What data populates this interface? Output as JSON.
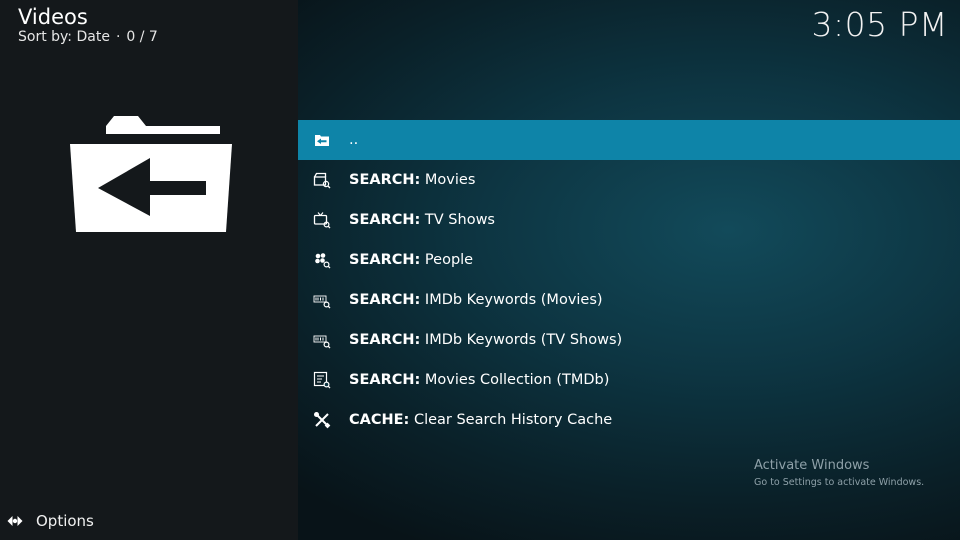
{
  "header": {
    "title": "Videos",
    "sort_label": "Sort by: Date",
    "position": "0 / 7",
    "clock": "3:05 PM"
  },
  "list": {
    "items": [
      {
        "icon": "back-folder-icon",
        "prefix": "",
        "text": ".."
      },
      {
        "icon": "movie-search-icon",
        "prefix": "SEARCH:",
        "text": " Movies"
      },
      {
        "icon": "tv-search-icon",
        "prefix": "SEARCH:",
        "text": " TV Shows"
      },
      {
        "icon": "people-search-icon",
        "prefix": "SEARCH:",
        "text": " People"
      },
      {
        "icon": "imdb-search-icon",
        "prefix": "SEARCH:",
        "text": " IMDb Keywords (Movies)"
      },
      {
        "icon": "imdb-search-icon",
        "prefix": "SEARCH:",
        "text": " IMDb Keywords (TV Shows)"
      },
      {
        "icon": "collection-search-icon",
        "prefix": "SEARCH:",
        "text": " Movies Collection (TMDb)"
      },
      {
        "icon": "tools-icon",
        "prefix": "CACHE:",
        "text": " Clear Search History Cache"
      }
    ],
    "selected_index": 0
  },
  "watermark": {
    "line1": "Activate Windows",
    "line2": "Go to Settings to activate Windows."
  },
  "footer": {
    "options_label": "Options"
  },
  "colors": {
    "selection": "#0e84a8",
    "left_panel": "#14181b",
    "background_glow": "#124a5a"
  }
}
